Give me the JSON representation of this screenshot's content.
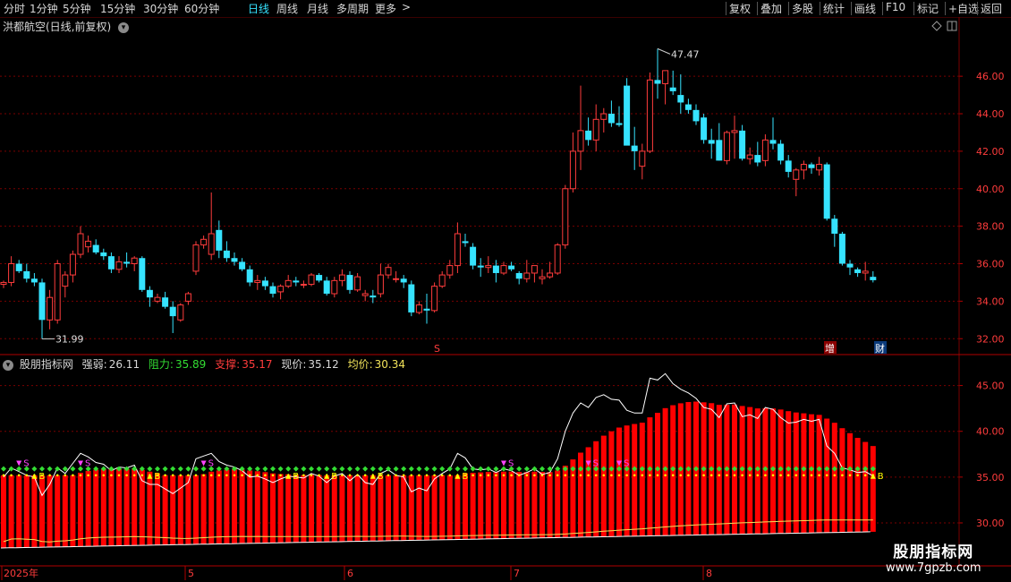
{
  "toolbar": {
    "periods": [
      "分时",
      "1分钟",
      "5分钟",
      "15分钟",
      "30分钟",
      "60分钟",
      "日线",
      "周线",
      "月线",
      "多周期",
      "更多"
    ],
    "active_period": "日线",
    "more_arrow": ">",
    "tools": [
      "复权",
      "叠加",
      "多股",
      "统计",
      "画线",
      "F10",
      "标记",
      "+自选",
      "返回"
    ]
  },
  "stock": {
    "title": "洪都航空(日线,前复权)",
    "high_label": "47.47",
    "low_label": "31.99"
  },
  "price_axis": {
    "ticks": [
      {
        "value": 32,
        "label": "32.00"
      },
      {
        "value": 34,
        "label": "34.00"
      },
      {
        "value": 36,
        "label": "36.00"
      },
      {
        "value": 38,
        "label": "38.00"
      },
      {
        "value": 40,
        "label": "40.00"
      },
      {
        "value": 42,
        "label": "42.00"
      },
      {
        "value": 44,
        "label": "44.00"
      },
      {
        "value": 46,
        "label": "46.00"
      }
    ],
    "range": [
      31.2,
      48.3
    ]
  },
  "markers": {
    "s": "S",
    "zeng": "增",
    "cai": "财"
  },
  "indicator": {
    "name": "股朋指标网",
    "strength_label": "强弱:",
    "strength_value": "26.11",
    "resist_label": "阻力:",
    "resist_value": "35.89",
    "support_label": "支撑:",
    "support_value": "35.17",
    "price_label": "现价:",
    "price_value": "35.12",
    "avg_label": "均价:",
    "avg_value": "30.34",
    "ticks": [
      {
        "value": 30,
        "label": "30.00"
      },
      {
        "value": 35,
        "label": "35.00"
      },
      {
        "value": 40,
        "label": "40.00"
      },
      {
        "value": 45,
        "label": "45.00"
      }
    ],
    "range": [
      25.5,
      47.5
    ],
    "buy_label": "B",
    "sell_label": "S"
  },
  "dates": {
    "year_label": "2025年",
    "months": [
      "5",
      "6",
      "7",
      "8"
    ]
  },
  "watermark": {
    "cn": "股朋指标网",
    "url": "www.7gpzb.com"
  },
  "colors": {
    "up": "#ff3c3c",
    "down": "#36e3ff",
    "active": "#36e3ff",
    "grid": "#7a0000",
    "bars": "#ff0000",
    "avg_line": "#f2e35a",
    "support_dots": "#33dd33",
    "buy": "#ffff00",
    "sell": "#ff44ff"
  },
  "chart_data": {
    "type": "candlestick",
    "title": "洪都航空(日线,前复权)",
    "x_labels": [
      "2025年",
      "5",
      "6",
      "7",
      "8"
    ],
    "ylim": [
      31.2,
      48.3
    ],
    "candles": [
      [
        34.9,
        35.1,
        34.7,
        35.0
      ],
      [
        35.0,
        36.4,
        34.8,
        36.0
      ],
      [
        36.0,
        36.2,
        35.5,
        35.6
      ],
      [
        35.6,
        36.0,
        35.0,
        35.2
      ],
      [
        35.2,
        35.5,
        34.8,
        35.0
      ],
      [
        35.0,
        35.2,
        31.99,
        33.0
      ],
      [
        33.0,
        34.6,
        32.5,
        34.2
      ],
      [
        33.0,
        36.2,
        32.8,
        36.0
      ],
      [
        34.8,
        35.6,
        34.2,
        35.4
      ],
      [
        35.4,
        36.7,
        35.0,
        36.5
      ],
      [
        36.5,
        38.0,
        36.3,
        37.6
      ],
      [
        36.9,
        37.5,
        36.6,
        37.2
      ],
      [
        37.0,
        37.3,
        36.5,
        36.6
      ],
      [
        36.6,
        36.8,
        36.2,
        36.4
      ],
      [
        36.4,
        36.6,
        35.5,
        35.7
      ],
      [
        35.7,
        36.4,
        35.5,
        36.1
      ],
      [
        36.1,
        36.6,
        35.8,
        36.0
      ],
      [
        36.0,
        36.4,
        35.6,
        36.3
      ],
      [
        36.3,
        36.4,
        34.5,
        34.6
      ],
      [
        34.6,
        34.8,
        33.7,
        34.2
      ],
      [
        34.0,
        34.4,
        33.9,
        34.2
      ],
      [
        34.2,
        34.5,
        33.6,
        33.7
      ],
      [
        33.7,
        34.0,
        32.3,
        33.2
      ],
      [
        33.0,
        33.9,
        32.9,
        33.8
      ],
      [
        34.0,
        34.5,
        33.8,
        34.4
      ],
      [
        35.6,
        37.2,
        35.4,
        37.0
      ],
      [
        37.0,
        37.5,
        36.8,
        37.3
      ],
      [
        36.5,
        39.8,
        36.2,
        37.6
      ],
      [
        37.8,
        38.3,
        36.3,
        36.7
      ],
      [
        36.7,
        37.2,
        36.1,
        36.3
      ],
      [
        36.3,
        36.6,
        35.9,
        36.1
      ],
      [
        36.1,
        36.3,
        35.6,
        35.7
      ],
      [
        35.7,
        35.9,
        34.8,
        35.0
      ],
      [
        35.0,
        35.4,
        34.6,
        35.1
      ],
      [
        35.1,
        35.3,
        34.6,
        34.8
      ],
      [
        34.8,
        35.0,
        34.2,
        34.4
      ],
      [
        34.5,
        34.9,
        34.1,
        34.8
      ],
      [
        34.8,
        35.4,
        34.7,
        35.1
      ],
      [
        35.1,
        35.3,
        34.8,
        35.0
      ],
      [
        34.9,
        35.1,
        34.7,
        34.9
      ],
      [
        34.9,
        35.5,
        34.8,
        35.4
      ],
      [
        35.4,
        35.5,
        35.0,
        35.1
      ],
      [
        35.1,
        35.3,
        34.3,
        34.4
      ],
      [
        34.4,
        35.3,
        34.2,
        35.1
      ],
      [
        35.1,
        35.7,
        34.8,
        35.4
      ],
      [
        35.4,
        35.6,
        34.4,
        34.6
      ],
      [
        34.6,
        35.5,
        34.5,
        35.3
      ],
      [
        34.3,
        34.6,
        34.0,
        34.4
      ],
      [
        34.3,
        34.6,
        33.9,
        34.2
      ],
      [
        34.4,
        36.0,
        34.2,
        35.4
      ],
      [
        35.4,
        36.0,
        35.2,
        35.8
      ],
      [
        35.2,
        35.6,
        35.0,
        35.2
      ],
      [
        35.2,
        35.4,
        34.7,
        35.0
      ],
      [
        34.9,
        35.1,
        33.2,
        33.4
      ],
      [
        33.4,
        34.0,
        33.3,
        33.8
      ],
      [
        33.6,
        34.4,
        32.8,
        33.5
      ],
      [
        33.5,
        35.0,
        33.4,
        34.8
      ],
      [
        34.8,
        35.6,
        34.7,
        35.4
      ],
      [
        35.4,
        36.2,
        35.2,
        35.9
      ],
      [
        35.9,
        38.2,
        35.5,
        37.6
      ],
      [
        37.2,
        37.6,
        36.9,
        37.1
      ],
      [
        36.9,
        37.1,
        35.7,
        35.9
      ],
      [
        35.9,
        36.3,
        35.3,
        35.8
      ],
      [
        35.8,
        36.4,
        35.5,
        35.9
      ],
      [
        35.9,
        36.2,
        35.0,
        35.5
      ],
      [
        35.5,
        36.1,
        35.4,
        35.9
      ],
      [
        35.9,
        36.1,
        35.6,
        35.7
      ],
      [
        35.5,
        35.6,
        34.9,
        35.2
      ],
      [
        35.2,
        36.2,
        35.0,
        35.5
      ],
      [
        35.5,
        35.8,
        35.0,
        35.9
      ],
      [
        35.2,
        35.7,
        34.9,
        35.3
      ],
      [
        35.3,
        36.1,
        35.2,
        35.5
      ],
      [
        35.5,
        37.1,
        35.4,
        37.0
      ],
      [
        37.0,
        40.2,
        36.8,
        40.0
      ],
      [
        40.0,
        43.0,
        39.8,
        42.0
      ],
      [
        42.0,
        45.5,
        41.0,
        43.1
      ],
      [
        43.1,
        43.8,
        42.3,
        42.6
      ],
      [
        42.6,
        44.5,
        42.0,
        43.7
      ],
      [
        43.7,
        44.3,
        43.0,
        44.0
      ],
      [
        44.0,
        44.7,
        43.3,
        43.5
      ],
      [
        43.5,
        44.4,
        43.3,
        43.4
      ],
      [
        45.5,
        45.9,
        42.5,
        42.3
      ],
      [
        42.3,
        43.3,
        41.0,
        42.0
      ],
      [
        41.2,
        42.4,
        40.5,
        42.0
      ],
      [
        42.0,
        46.2,
        41.9,
        45.8
      ],
      [
        45.8,
        47.47,
        44.8,
        45.6
      ],
      [
        45.6,
        46.0,
        44.5,
        46.3
      ],
      [
        45.4,
        46.3,
        45.0,
        45.2
      ],
      [
        45.0,
        46.1,
        44.0,
        44.6
      ],
      [
        44.5,
        44.8,
        44.0,
        44.2
      ],
      [
        44.2,
        44.5,
        43.4,
        43.6
      ],
      [
        43.8,
        44.0,
        42.4,
        42.6
      ],
      [
        42.6,
        43.2,
        41.6,
        42.4
      ],
      [
        42.6,
        43.5,
        41.5,
        41.5
      ],
      [
        41.5,
        43.1,
        41.3,
        43.0
      ],
      [
        43.0,
        43.9,
        41.6,
        43.1
      ],
      [
        43.1,
        43.4,
        41.5,
        41.6
      ],
      [
        41.6,
        42.2,
        41.3,
        41.8
      ],
      [
        41.8,
        42.5,
        41.2,
        41.4
      ],
      [
        41.5,
        42.9,
        41.2,
        42.6
      ],
      [
        42.6,
        43.8,
        42.1,
        42.4
      ],
      [
        42.4,
        42.6,
        41.3,
        41.5
      ],
      [
        41.5,
        41.8,
        40.6,
        40.9
      ],
      [
        40.5,
        41.1,
        39.6,
        41.0
      ],
      [
        41.0,
        41.5,
        40.5,
        41.3
      ],
      [
        41.3,
        41.4,
        40.8,
        41.1
      ],
      [
        41.0,
        41.7,
        40.7,
        41.3
      ],
      [
        41.3,
        41.4,
        38.3,
        38.4
      ],
      [
        38.4,
        38.6,
        36.9,
        37.6
      ],
      [
        37.6,
        37.7,
        35.9,
        36.0
      ],
      [
        36.0,
        36.2,
        35.4,
        35.8
      ],
      [
        35.7,
        35.8,
        35.3,
        35.5
      ],
      [
        35.5,
        36.1,
        35.1,
        35.6
      ],
      [
        35.3,
        35.6,
        35.0,
        35.12
      ]
    ]
  }
}
